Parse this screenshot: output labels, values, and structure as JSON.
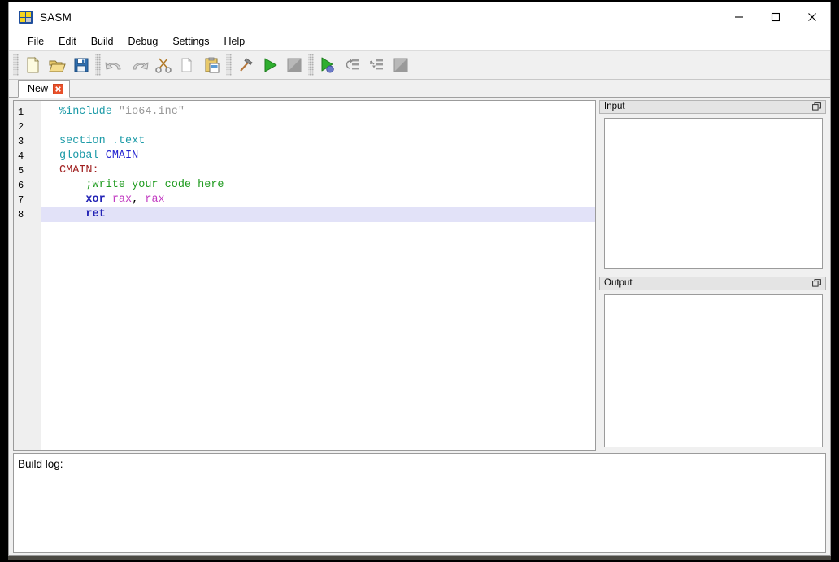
{
  "window": {
    "title": "SASM",
    "app_icon": "sasm-logo-icon",
    "controls": {
      "minimize": "minimize-icon",
      "maximize": "maximize-icon",
      "close": "close-icon"
    }
  },
  "menubar": {
    "items": [
      {
        "label": "File"
      },
      {
        "label": "Edit"
      },
      {
        "label": "Build"
      },
      {
        "label": "Debug"
      },
      {
        "label": "Settings"
      },
      {
        "label": "Help"
      }
    ]
  },
  "toolbar": {
    "groups": [
      {
        "buttons": [
          {
            "name": "new-file-button",
            "icon": "new-file-icon"
          },
          {
            "name": "open-file-button",
            "icon": "open-folder-icon"
          },
          {
            "name": "save-file-button",
            "icon": "save-floppy-icon"
          }
        ]
      },
      {
        "buttons": [
          {
            "name": "undo-button",
            "icon": "undo-arrow-icon"
          },
          {
            "name": "redo-button",
            "icon": "redo-arrow-icon"
          },
          {
            "name": "cut-button",
            "icon": "scissors-icon"
          },
          {
            "name": "copy-button",
            "icon": "copy-pages-icon"
          },
          {
            "name": "paste-button",
            "icon": "paste-clipboard-icon"
          }
        ]
      },
      {
        "buttons": [
          {
            "name": "build-button",
            "icon": "hammer-icon"
          },
          {
            "name": "run-button",
            "icon": "green-play-triangle-icon"
          },
          {
            "name": "stop-button",
            "icon": "stop-square-icon"
          }
        ]
      },
      {
        "buttons": [
          {
            "name": "debug-button",
            "icon": "debug-play-bug-icon"
          },
          {
            "name": "step-over-button",
            "icon": "step-over-icon"
          },
          {
            "name": "step-into-button",
            "icon": "step-into-icon"
          },
          {
            "name": "stop-debug-button",
            "icon": "stop-square-icon"
          }
        ]
      }
    ]
  },
  "tabs": [
    {
      "label": "New",
      "close_icon": "tab-close-x-icon",
      "active": true
    }
  ],
  "editor": {
    "line_numbers": [
      "1",
      "2",
      "3",
      "4",
      "5",
      "6",
      "7",
      "8"
    ],
    "current_line": 8,
    "lines": [
      {
        "n": 1,
        "tokens": [
          {
            "t": "%include ",
            "c": "directive"
          },
          {
            "t": "\"io64.inc\"",
            "c": "string"
          }
        ]
      },
      {
        "n": 2,
        "tokens": []
      },
      {
        "n": 3,
        "tokens": [
          {
            "t": "section .text",
            "c": "keyword"
          }
        ]
      },
      {
        "n": 4,
        "tokens": [
          {
            "t": "global ",
            "c": "keyword"
          },
          {
            "t": "CMAIN",
            "c": "labelref"
          }
        ]
      },
      {
        "n": 5,
        "tokens": [
          {
            "t": "CMAIN:",
            "c": "label"
          }
        ]
      },
      {
        "n": 6,
        "tokens": [
          {
            "t": "    ;write your code here",
            "c": "comment"
          }
        ]
      },
      {
        "n": 7,
        "tokens": [
          {
            "t": "    ",
            "c": "punct"
          },
          {
            "t": "xor",
            "c": "instr"
          },
          {
            "t": " ",
            "c": "punct"
          },
          {
            "t": "rax",
            "c": "reg"
          },
          {
            "t": ", ",
            "c": "punct"
          },
          {
            "t": "rax",
            "c": "reg"
          }
        ]
      },
      {
        "n": 8,
        "tokens": [
          {
            "t": "    ",
            "c": "punct"
          },
          {
            "t": "ret",
            "c": "instr"
          }
        ]
      }
    ]
  },
  "docks": {
    "input": {
      "title": "Input",
      "float_icon": "float-dock-icon",
      "value": ""
    },
    "output": {
      "title": "Output",
      "float_icon": "float-dock-icon",
      "value": ""
    }
  },
  "build_log": {
    "text": "Build log:"
  },
  "colors": {
    "accent_tab_close": "#e8502a",
    "current_line_highlight": "#e2e2f8",
    "directive": "#1d9ba8",
    "string": "#999999",
    "label": "#a02020",
    "labelref": "#2020d0",
    "comment": "#1f9b1f",
    "instruction": "#2323b5",
    "register": "#c23bc2",
    "chrome": "#f0f0f0"
  }
}
